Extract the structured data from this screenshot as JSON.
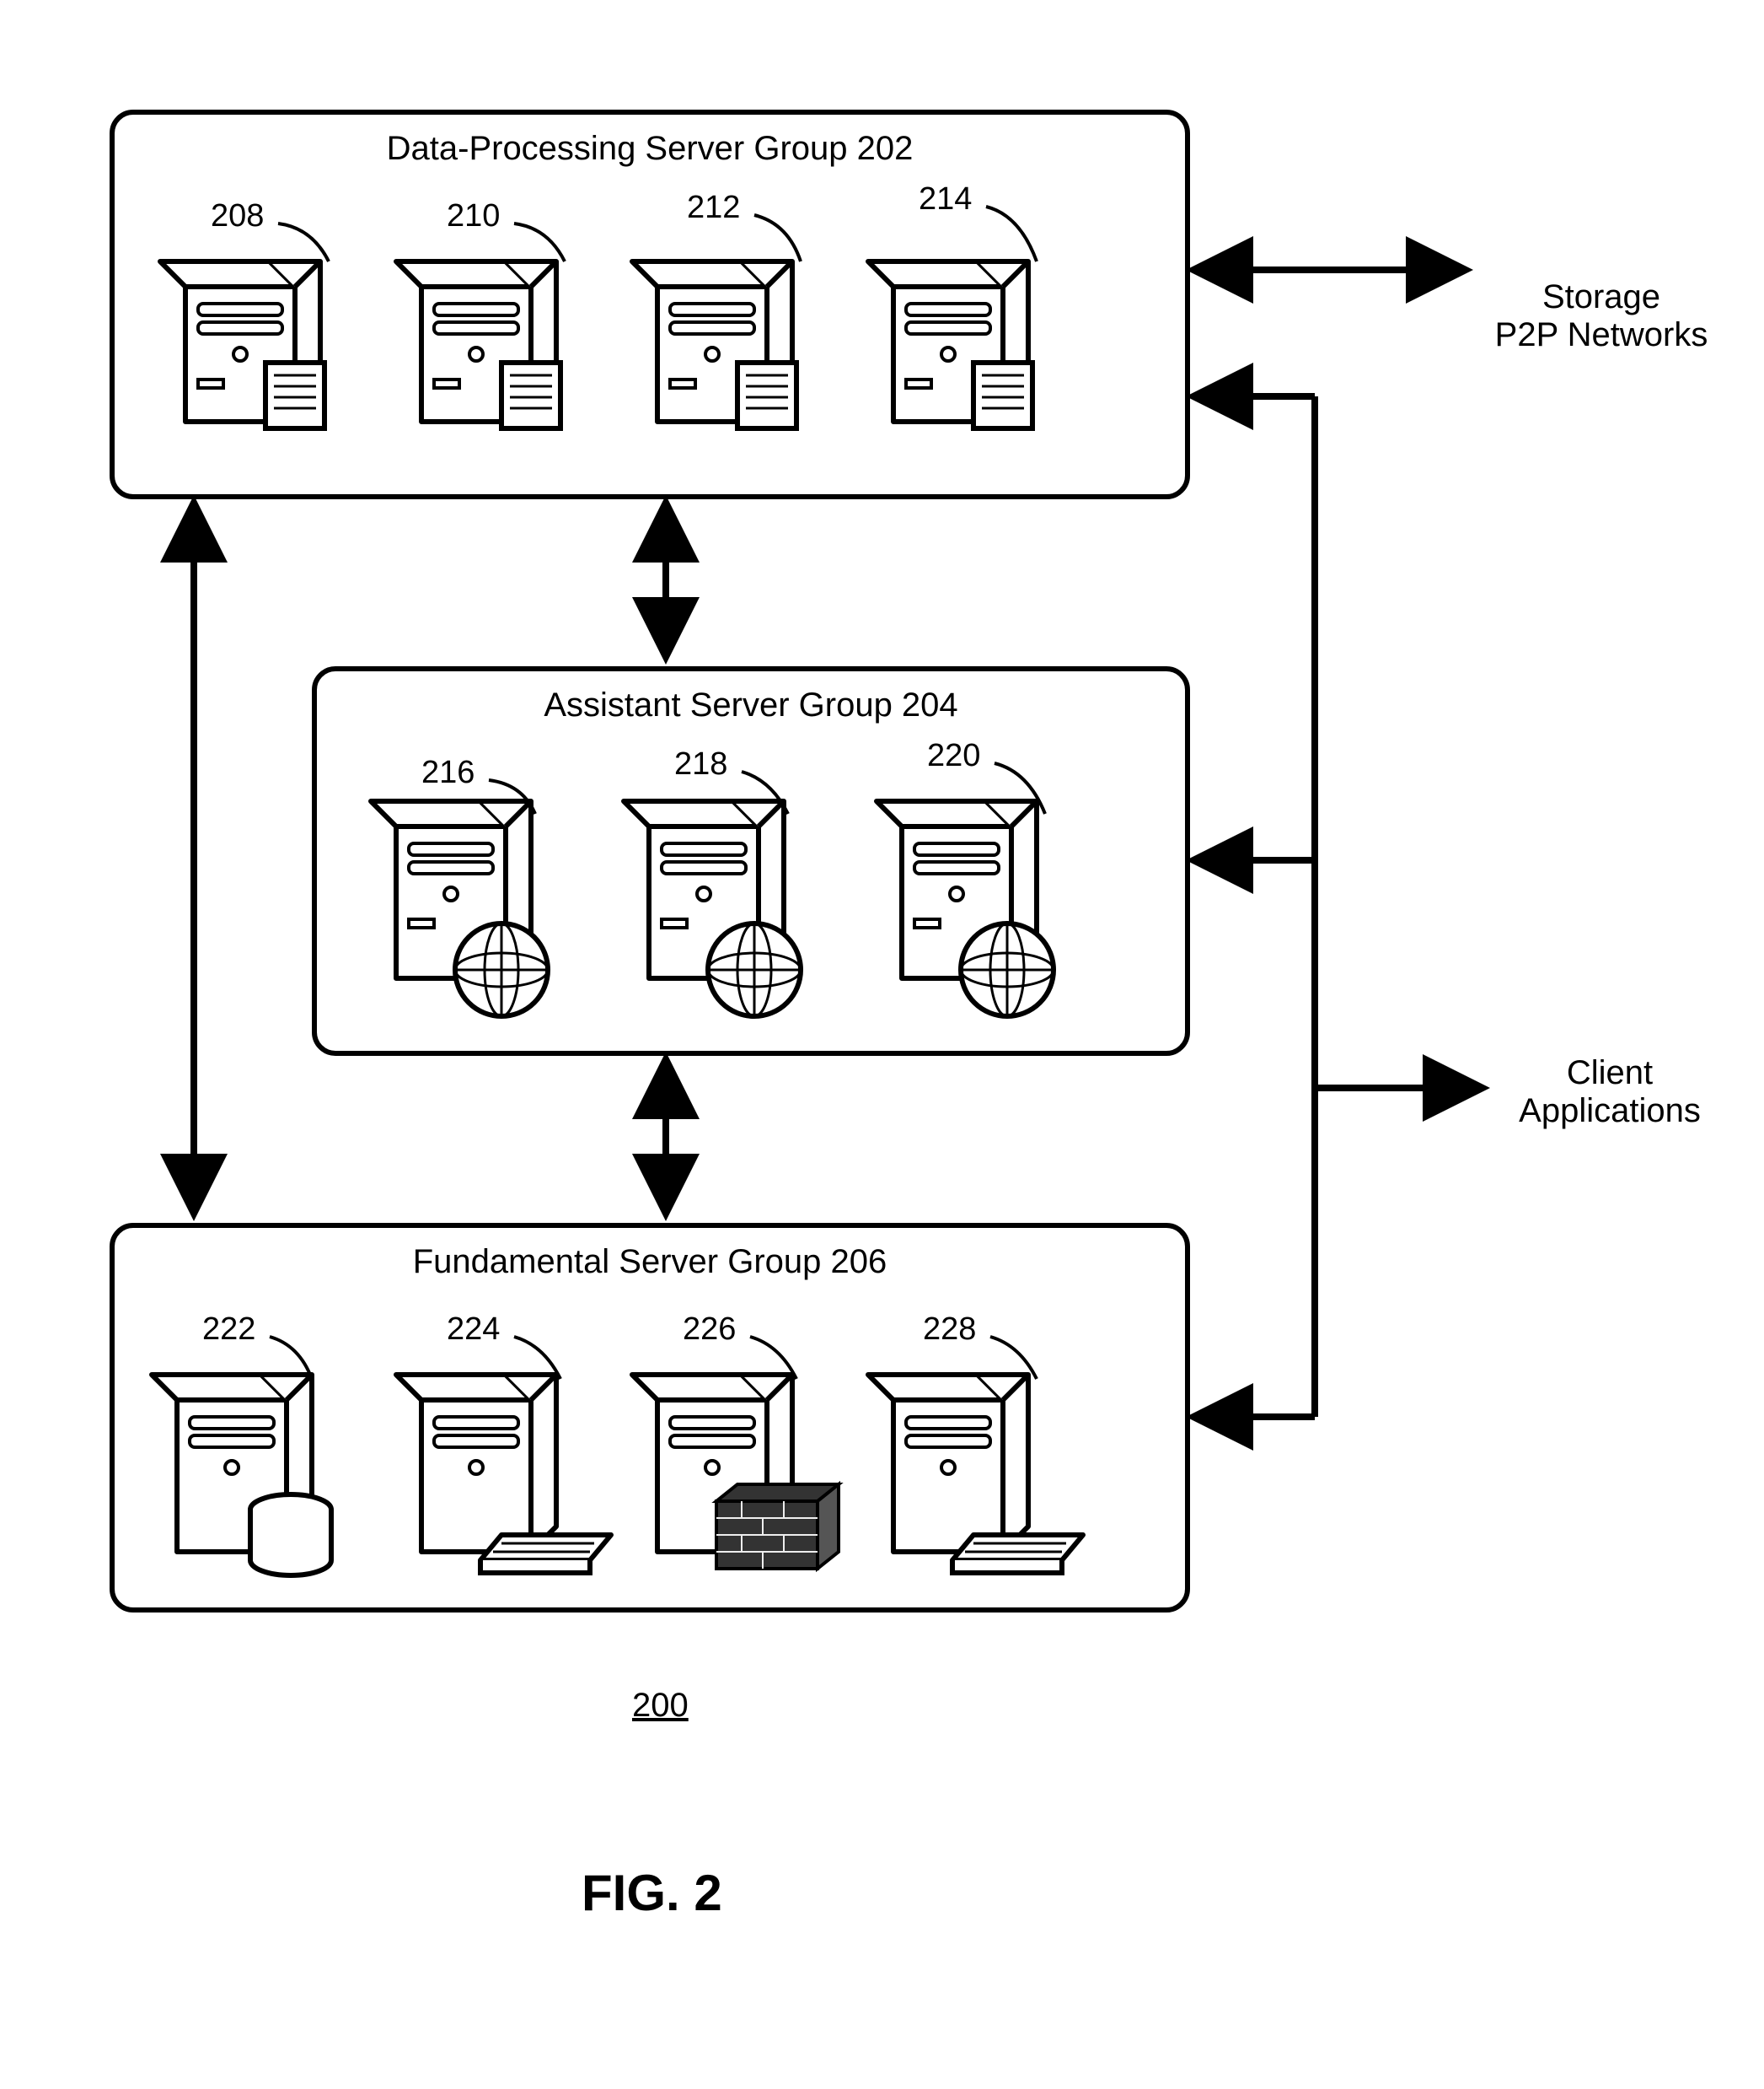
{
  "figure": {
    "caption": "FIG. 2",
    "system_ref": "200"
  },
  "external": {
    "storage": "Storage\nP2P Networks",
    "client": "Client\nApplications"
  },
  "groups": {
    "dp": {
      "title": "Data-Processing Server Group 202",
      "servers": [
        "208",
        "210",
        "212",
        "214"
      ]
    },
    "asst": {
      "title": "Assistant Server Group 204",
      "servers": [
        "216",
        "218",
        "220"
      ]
    },
    "fund": {
      "title": "Fundamental Server Group 206",
      "servers": [
        "222",
        "224",
        "226",
        "228"
      ]
    }
  }
}
